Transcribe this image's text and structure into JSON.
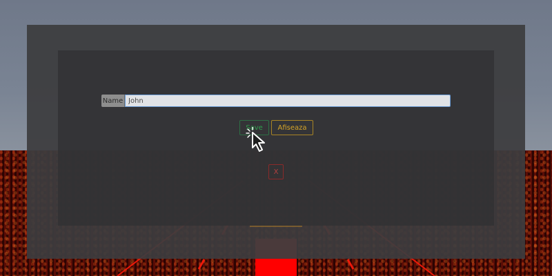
{
  "form": {
    "name_label": "Name",
    "name_value": "John",
    "name_placeholder": ""
  },
  "buttons": {
    "save_label": "Save",
    "show_label": "Afiseaza",
    "close_label": "X"
  },
  "colors": {
    "save": "#2fa04d",
    "show": "#d6a528",
    "close": "#b34040",
    "input_focus_border": "#6a9bd6",
    "road_glow": "#ff0000"
  },
  "icons": {
    "cursor": "mouse-pointer-icon"
  }
}
